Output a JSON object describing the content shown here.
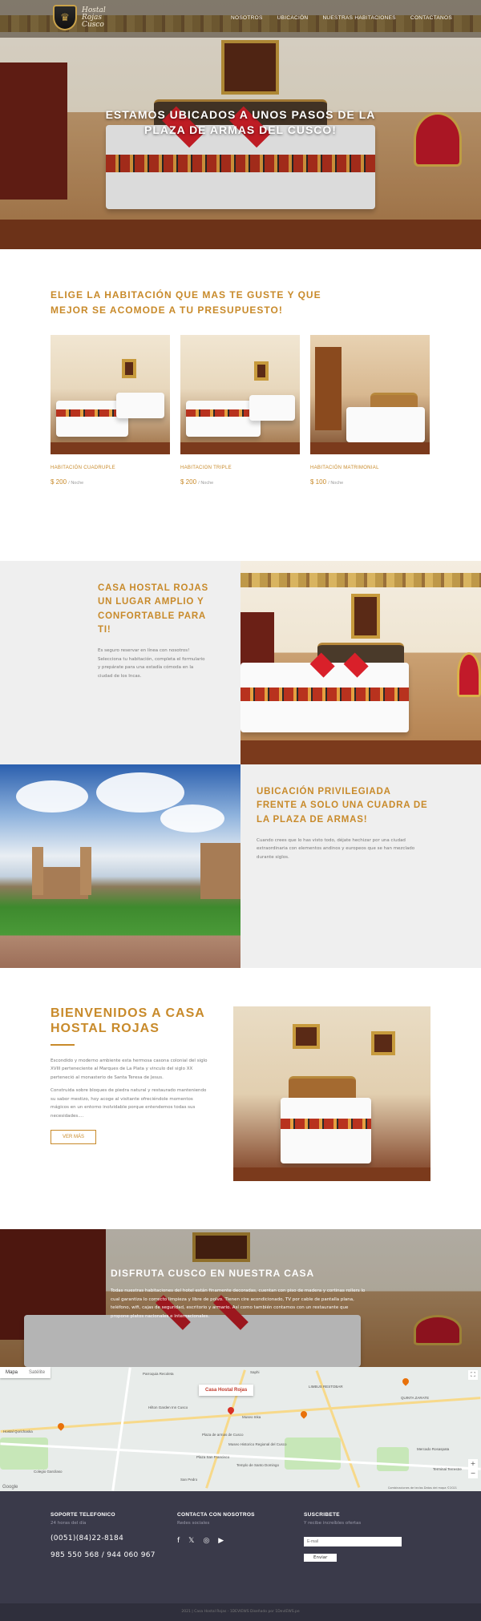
{
  "brand": {
    "line1": "Hostal",
    "line2": "Rojas",
    "line3": "Cusco"
  },
  "nav": [
    "Nosotros",
    "Ubicación",
    "Nuestras Habitaciones",
    "Contactanos"
  ],
  "hero": {
    "title": "Estamos ubicados a unos pasos de la Plaza de Armas del Cusco!"
  },
  "rooms": {
    "heading": "Elige la habitación que mas te guste y que mejor se acomode a tu presupuesto!",
    "items": [
      {
        "name": "Habitación Cuadruple",
        "price": "$ 200",
        "unit": "/ Noche"
      },
      {
        "name": "Habitacion Triple",
        "price": "$ 200",
        "unit": "/ Noche"
      },
      {
        "name": "Habitación Matrimonial",
        "price": "$ 100",
        "unit": "/ Noche"
      }
    ]
  },
  "about": {
    "heading": "Casa Hostal Rojas un lugar amplio y confortable para ti!",
    "text": "Es seguro reservar en línea con nosotros! Selecciona tu habitación, completa el formulario y prepárate para una estadía cómoda en la ciudad de los Incas."
  },
  "location": {
    "heading": "Ubicación privilegiada frente a solo una cuadra de la plaza de armas!",
    "text": "Cuando crees que lo has visto todo, déjate hechizar por una ciudad extraordinaria con elementos andinos y europeos que se han mezclado durante siglos."
  },
  "welcome": {
    "heading": "Bienvenidos a Casa Hostal Rojas",
    "p1": "Escondido y moderno ambiente esta hermosa casona colonial del siglo XVIII perteneciente al Marques de La Plata y vinculo del siglo XX perteneció al monasterio de Santa Teresa de Jesus.",
    "p2": "Construida sobre bloques de piedra natural y restaurado manteniendo su sabor mestizo, hoy acoge al visitante ofreciéndole momentos mágicos en un entorno inolvidable porque entendemos todas sus necesidades....",
    "button": "Ver más"
  },
  "enjoy": {
    "heading": "Disfruta Cusco en nuestra casa",
    "text": "Todas nuestras habitaciones del hotel están finamente decoradas, cuentan con piso de madera y cortinas rollers lo cual garantiza lo correcto limpieza y libre de polvo. Tienen cire acondicionado, TV por cable de pantalla plana, teléfono, wifi, cajas de seguridad, escritorio y armario. Así como también contamos con un restaurante que propone platos nacionales e internacionales."
  },
  "map": {
    "tab_map": "Mapa",
    "tab_satellite": "Satélite",
    "marker": "Casa Hostal Rojas",
    "google": "Google",
    "attribution": "Combinaciones de teclas  Datos del mapa ©2021",
    "labels": [
      "Parroquia Recoleta",
      "Saphi",
      "LIMBUS RESTOBAR",
      "Museo Inka",
      "Plaza de armas de Cusco",
      "Museo Historico Regional del Cusco",
      "Hilton Garden Inn Cusco",
      "Plaza San Francisco",
      "Templo de Santo Domingo",
      "Mercado Rosaspata",
      "QUINTA ZARATE",
      "Colegio Garcilaso",
      "Hostal Qorichaska",
      "San Pedro",
      "Terminal Terrestre"
    ]
  },
  "footer": {
    "support": {
      "title": "Soporte telefonico",
      "sub": "24 horas del día",
      "phone1": "(0051)(84)22-8184",
      "phone2": "985 550 568 / 944 060 967"
    },
    "contact": {
      "title": "Contacta con nosotros",
      "sub": "Redes sociales"
    },
    "subscribe": {
      "title": "Suscribete",
      "sub": "Y recibe increíbles ofertas",
      "placeholder": "E-mail",
      "button": "Enviar"
    },
    "copyright": "2021 | Casa Hostal Rojas - 1DEVIEWS Diseñado por 1DevIEWS.pe"
  }
}
